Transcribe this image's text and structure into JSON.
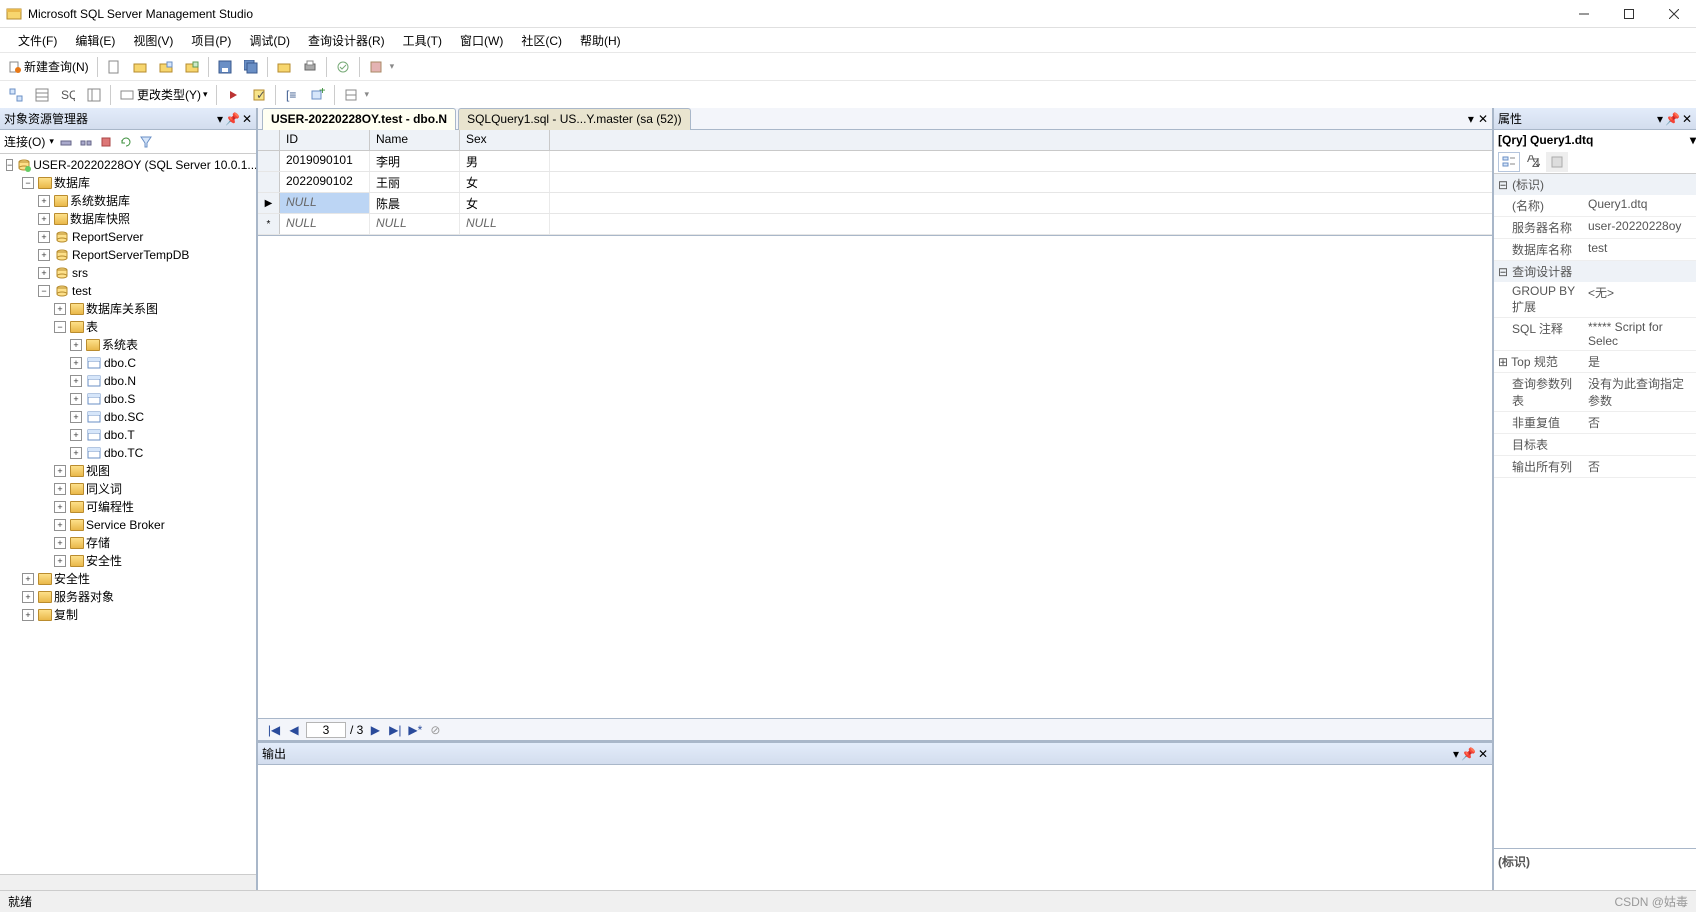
{
  "app": {
    "title": "Microsoft SQL Server Management Studio"
  },
  "menu": [
    "文件(F)",
    "编辑(E)",
    "视图(V)",
    "项目(P)",
    "调试(D)",
    "查询设计器(R)",
    "工具(T)",
    "窗口(W)",
    "社区(C)",
    "帮助(H)"
  ],
  "toolbar1": {
    "new_query": "新建查询(N)"
  },
  "toolbar2": {
    "change_type": "更改类型(Y)"
  },
  "left": {
    "title": "对象资源管理器",
    "connect_label": "连接(O)",
    "server": "USER-20220228OY (SQL Server 10.0.1...",
    "db_root": "数据库",
    "items": {
      "sysdb": "系统数据库",
      "snap": "数据库快照",
      "rs": "ReportServer",
      "rstmp": "ReportServerTempDB",
      "srs": "srs",
      "test": "test",
      "diagram": "数据库关系图",
      "tables": "表",
      "systables": "系统表",
      "t_c": "dbo.C",
      "t_n": "dbo.N",
      "t_s": "dbo.S",
      "t_sc": "dbo.SC",
      "t_t": "dbo.T",
      "t_tc": "dbo.TC",
      "views": "视图",
      "synonyms": "同义词",
      "prog": "可编程性",
      "sb": "Service Broker",
      "storage": "存储",
      "sec_db": "安全性",
      "sec": "安全性",
      "svrobj": "服务器对象",
      "repl": "复制"
    }
  },
  "tabs": {
    "active": "USER-20220228OY.test - dbo.N",
    "inactive": "SQLQuery1.sql - US...Y.master (sa (52))"
  },
  "grid": {
    "columns": [
      "ID",
      "Name",
      "Sex"
    ],
    "rows": [
      {
        "marker": "",
        "cells": [
          "2019090101",
          "李明",
          "男"
        ],
        "nulls": [
          false,
          false,
          false
        ],
        "sel": -1
      },
      {
        "marker": "",
        "cells": [
          "2022090102",
          "王丽",
          "女"
        ],
        "nulls": [
          false,
          false,
          false
        ],
        "sel": -1
      },
      {
        "marker": "▶",
        "cells": [
          "NULL",
          "陈晨",
          "女"
        ],
        "nulls": [
          true,
          false,
          false
        ],
        "sel": 0
      },
      {
        "marker": "*",
        "cells": [
          "NULL",
          "NULL",
          "NULL"
        ],
        "nulls": [
          true,
          true,
          true
        ],
        "sel": -1
      }
    ],
    "nav": {
      "pos": "3",
      "total": "/ 3"
    }
  },
  "output": {
    "title": "输出"
  },
  "props": {
    "title": "属性",
    "obj": "[Qry] Query1.dtq",
    "cat1": "(标识)",
    "rows1": [
      {
        "n": "(名称)",
        "v": "Query1.dtq"
      },
      {
        "n": "服务器名称",
        "v": "user-20220228oy"
      },
      {
        "n": "数据库名称",
        "v": "test"
      }
    ],
    "cat2": "查询设计器",
    "rows2": [
      {
        "n": "GROUP BY 扩展",
        "v": "<无>"
      },
      {
        "n": "SQL 注释",
        "v": "***** Script for Selec"
      },
      {
        "n": "Top 规范",
        "v": "是",
        "exp": true
      },
      {
        "n": "查询参数列表",
        "v": "没有为此查询指定参数"
      },
      {
        "n": "非重复值",
        "v": "否"
      },
      {
        "n": "目标表",
        "v": ""
      },
      {
        "n": "输出所有列",
        "v": "否"
      }
    ],
    "desc_title": "(标识)"
  },
  "status": {
    "ready": "就绪",
    "watermark": "CSDN @姑毒"
  }
}
